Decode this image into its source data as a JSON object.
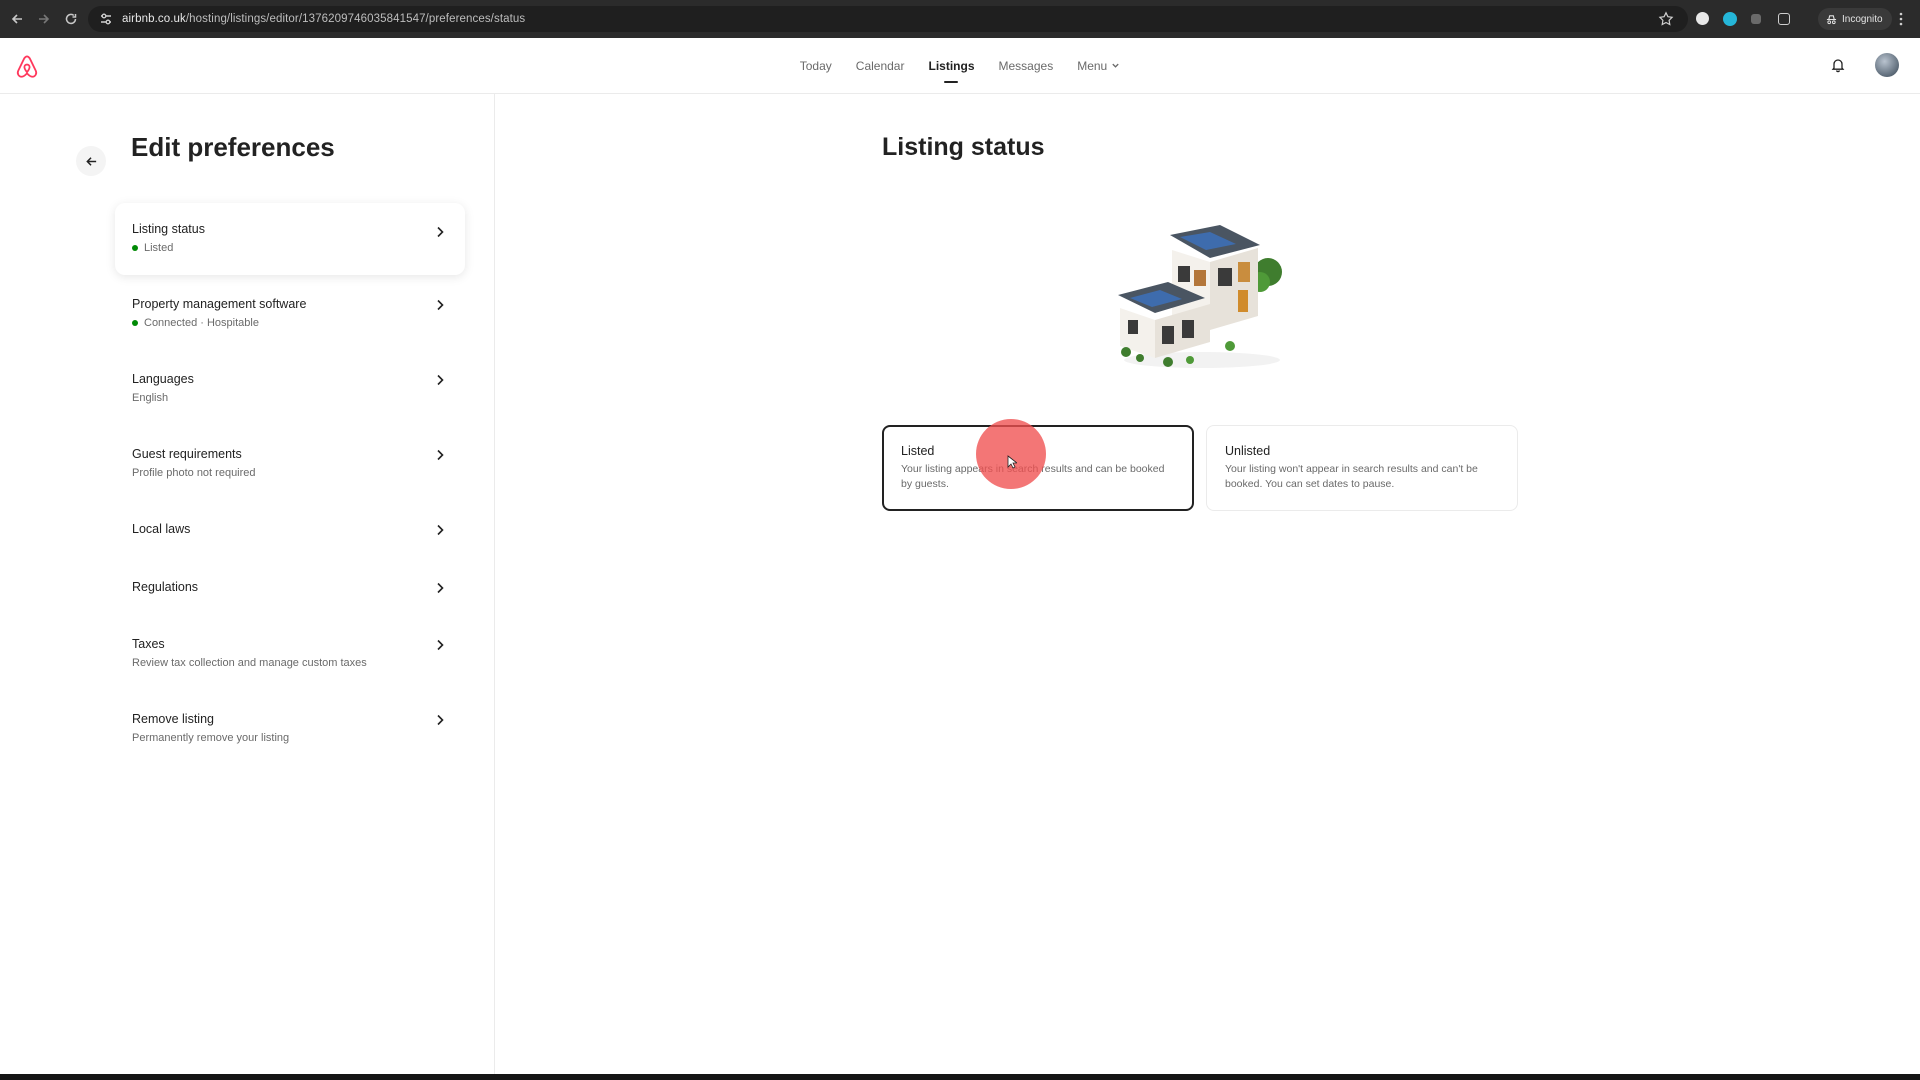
{
  "browser": {
    "url_host": "airbnb.co.uk",
    "url_path": "/hosting/listings/editor/1376209746035841547/preferences/status",
    "incognito_label": "Incognito"
  },
  "header": {
    "nav": [
      "Today",
      "Calendar",
      "Listings",
      "Messages",
      "Menu"
    ],
    "active_nav": "Listings",
    "brand_color": "#ff385c"
  },
  "left": {
    "title": "Edit preferences",
    "items": [
      {
        "title": "Listing status",
        "subtitle": "Listed",
        "status_dot": true
      },
      {
        "title": "Property management software",
        "subtitle": "Connected · Hospitable",
        "status_dot": true
      },
      {
        "title": "Languages",
        "subtitle": "English"
      },
      {
        "title": "Guest requirements",
        "subtitle": "Profile photo not required"
      },
      {
        "title": "Local laws",
        "subtitle": ""
      },
      {
        "title": "Regulations",
        "subtitle": ""
      },
      {
        "title": "Taxes",
        "subtitle": "Review tax collection and manage custom taxes"
      },
      {
        "title": "Remove listing",
        "subtitle": "Permanently remove your listing"
      }
    ]
  },
  "main": {
    "title": "Listing status",
    "options": [
      {
        "title": "Listed",
        "description": "Your listing appears in search results and can be booked by guests.",
        "selected": true
      },
      {
        "title": "Unlisted",
        "description": "Your listing won't appear in search results and can't be booked. You can set dates to pause.",
        "selected": false
      }
    ]
  }
}
